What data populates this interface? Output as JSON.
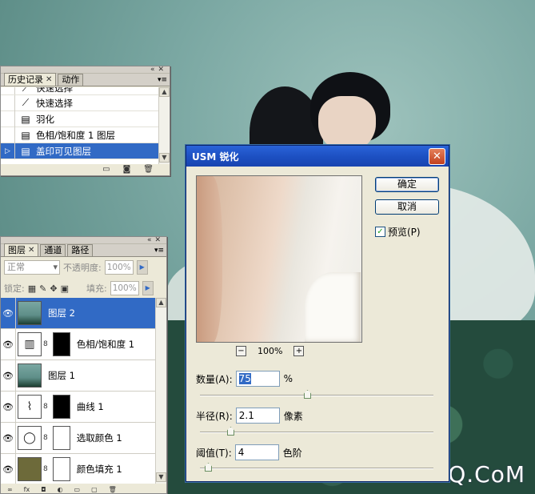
{
  "background": {
    "watermark": "UiBQ.CoM"
  },
  "history_panel": {
    "tabs": [
      "历史记录",
      "动作"
    ],
    "items": [
      {
        "label": "快速选择",
        "selected": false
      },
      {
        "label": "快速选择",
        "selected": false
      },
      {
        "label": "羽化",
        "selected": false
      },
      {
        "label": "色相/饱和度 1 图层",
        "selected": false
      },
      {
        "label": "盖印可见图层",
        "selected": true
      }
    ]
  },
  "layers_panel": {
    "tabs": [
      "图层",
      "通道",
      "路径"
    ],
    "blend_mode": "正常",
    "opacity_label": "不透明度:",
    "opacity_value": "100%",
    "lock_label": "锁定:",
    "fill_label": "填充:",
    "fill_value": "100%",
    "layers": [
      {
        "name": "图层 2",
        "selected": true
      },
      {
        "name": "色相/饱和度 1",
        "selected": false
      },
      {
        "name": "图层 1",
        "selected": false
      },
      {
        "name": "曲线 1",
        "selected": false
      },
      {
        "name": "选取颜色 1",
        "selected": false
      },
      {
        "name": "颜色填充 1",
        "selected": false
      }
    ]
  },
  "usm_dialog": {
    "title": "USM 锐化",
    "ok_label": "确定",
    "cancel_label": "取消",
    "preview_label": "预览(P)",
    "preview_checked": true,
    "zoom": "100%",
    "amount": {
      "label": "数量(A):",
      "value": "75",
      "unit": "%",
      "slider_fraction": 0.46
    },
    "radius": {
      "label": "半径(R):",
      "value": "2.1",
      "unit": "像素",
      "slider_fraction": 0.12
    },
    "threshold": {
      "label": "阈值(T):",
      "value": "4",
      "unit": "色阶",
      "slider_fraction": 0.02
    }
  }
}
